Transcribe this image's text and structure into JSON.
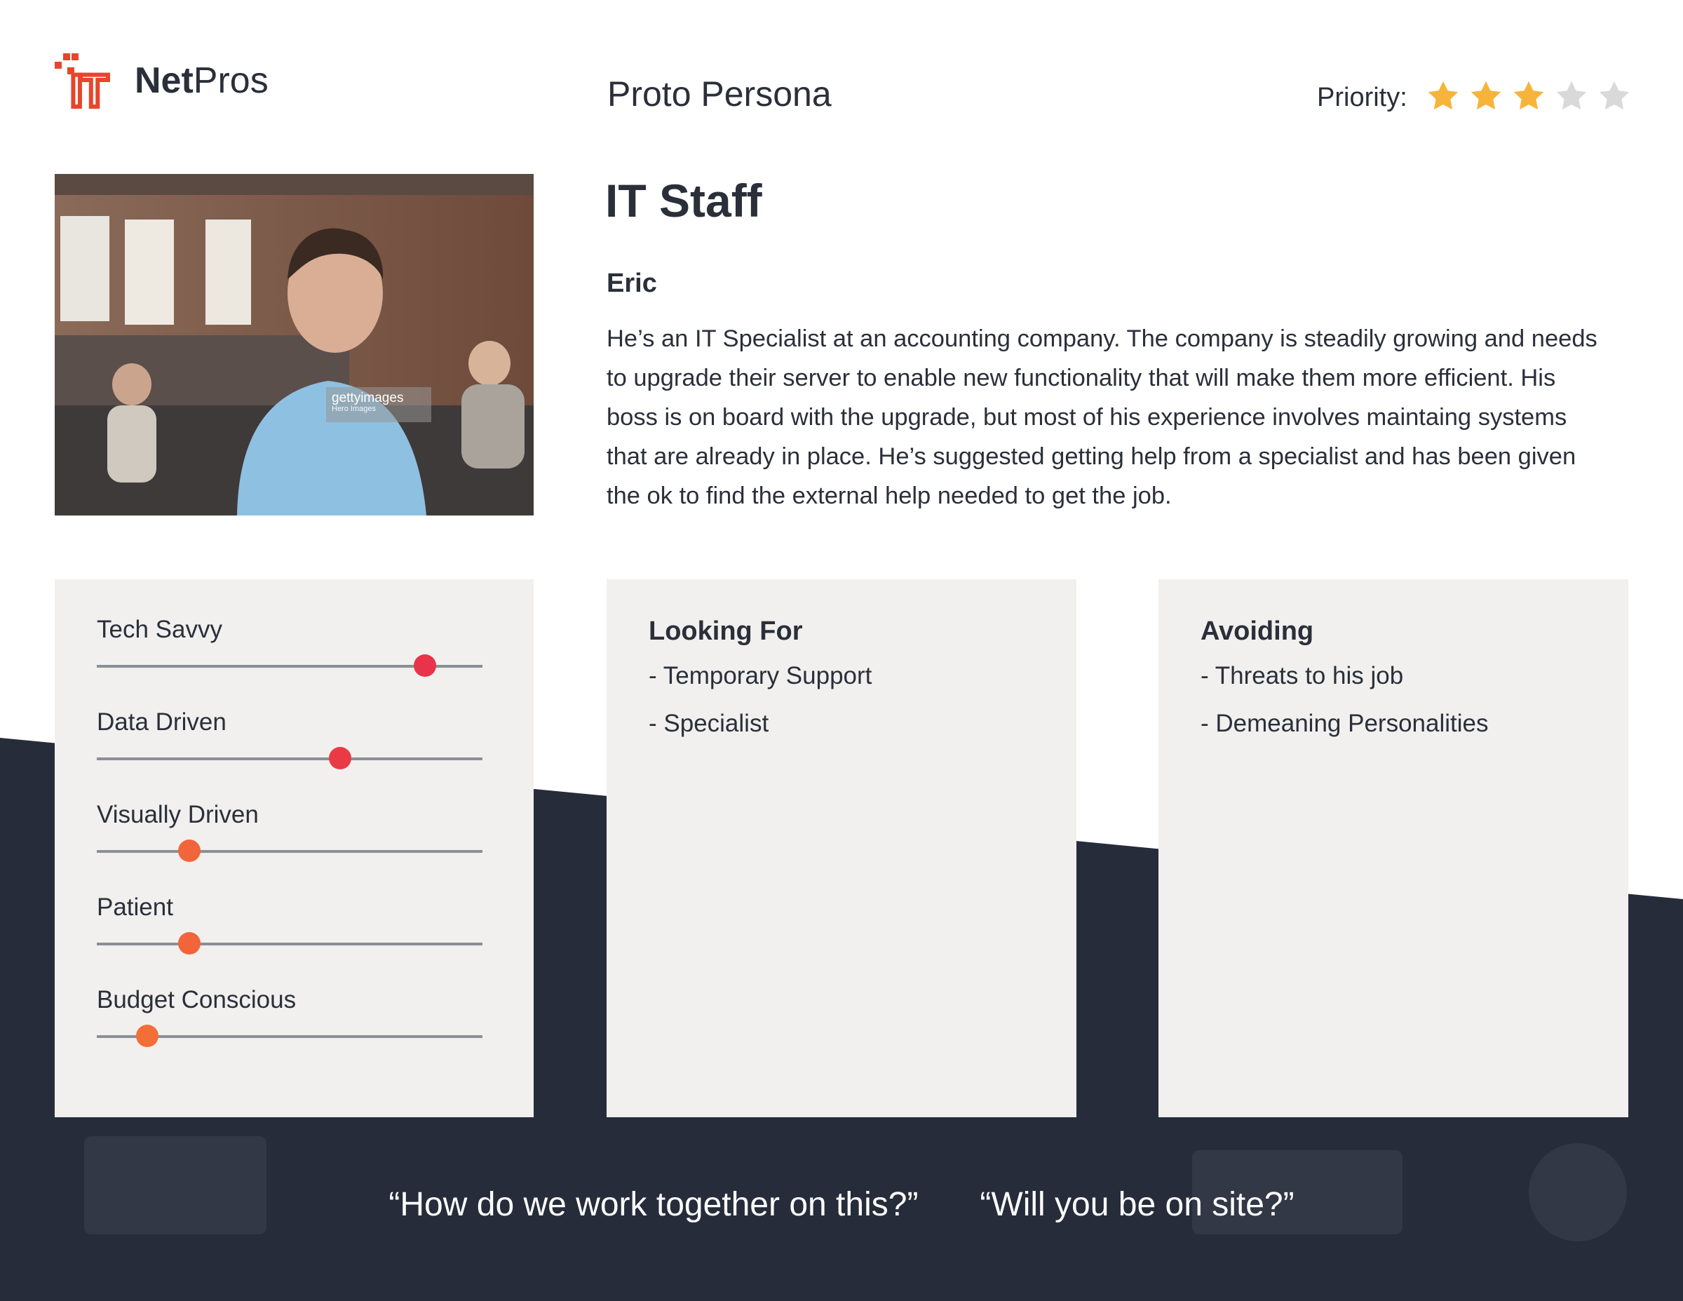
{
  "header": {
    "logo": {
      "mark": "IT",
      "text_bold": "Net",
      "text_regular": "Pros"
    },
    "page_title": "Proto Persona",
    "priority": {
      "label": "Priority:",
      "rating": 3,
      "max": 5
    }
  },
  "photo": {
    "watermark_brand": "gettyimages",
    "watermark_credit": "Hero Images"
  },
  "persona": {
    "role": "IT Staff",
    "name": "Eric",
    "bio": "He’s an IT Specialist at an accounting company. The company is steadily growing and needs to upgrade their server to enable new functionality that will make them more efficient. His boss is on board with the upgrade, but most of his experience involves maintaing systems that are already in place. He’s suggested getting help from a specialist and has been given the ok to find the external help needed to get the job."
  },
  "traits": [
    {
      "label": "Tech Savvy",
      "level": 0.85,
      "color": "#e8334a"
    },
    {
      "label": "Data Driven",
      "level": 0.63,
      "color": "#ea3a45"
    },
    {
      "label": "Visually Driven",
      "level": 0.24,
      "color": "#f2643a"
    },
    {
      "label": "Patient",
      "level": 0.24,
      "color": "#f2643a"
    },
    {
      "label": "Budget Conscious",
      "level": 0.13,
      "color": "#f46e38"
    }
  ],
  "looking_for": {
    "heading": "Looking For",
    "items": [
      "- Temporary Support",
      "- Specialist"
    ]
  },
  "avoiding": {
    "heading": "Avoiding",
    "items": [
      "- Threats to his job",
      "- Demeaning Personalities"
    ]
  },
  "quotes": [
    "“How do we work together on this?”",
    "“Will you be on site?”"
  ],
  "colors": {
    "dark_band": "#262c3a",
    "card_bg": "#f1f0ee",
    "brand_red": "#e8452c",
    "star_filled": "#f7b43b",
    "star_empty": "#d9d9d9"
  }
}
